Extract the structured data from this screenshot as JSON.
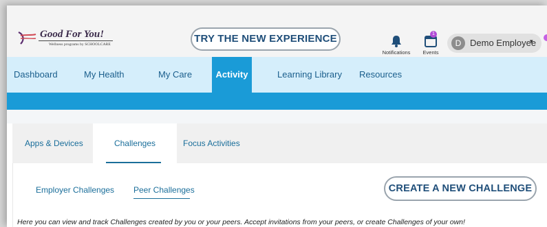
{
  "brand": {
    "name": "Good For You!",
    "tagline": "Wellness programs by SCHOOLCARE"
  },
  "header": {
    "try_button": "TRY THE NEW EXPERIENCE",
    "notifications_label": "Notifications",
    "events_label": "Events",
    "events_badge": "1",
    "user_initial": "D",
    "user_name": "Demo Employee",
    "user_caret": "▾"
  },
  "nav": {
    "items": [
      {
        "label": "Dashboard"
      },
      {
        "label": "My Health"
      },
      {
        "label": "My Care"
      },
      {
        "label": "Activity"
      },
      {
        "label": "Learning Library"
      },
      {
        "label": "Resources"
      }
    ],
    "active": "Activity"
  },
  "tabs": {
    "items": [
      {
        "label": "Apps & Devices"
      },
      {
        "label": "Challenges"
      },
      {
        "label": "Focus Activities"
      }
    ],
    "active": "Challenges"
  },
  "subtabs": {
    "items": [
      {
        "label": "Employer Challenges"
      },
      {
        "label": "Peer Challenges"
      }
    ],
    "active": "Peer Challenges"
  },
  "create_button": "CREATE A NEW CHALLENGE",
  "description": "Here you can view and track Challenges created by you or your peers. Accept invitations from your peers, or create Challenges of your own!",
  "colors": {
    "nav_bg": "#d5eefb",
    "accent": "#1a9bd7",
    "link": "#1a6e9a",
    "badge": "#b14bd6"
  }
}
